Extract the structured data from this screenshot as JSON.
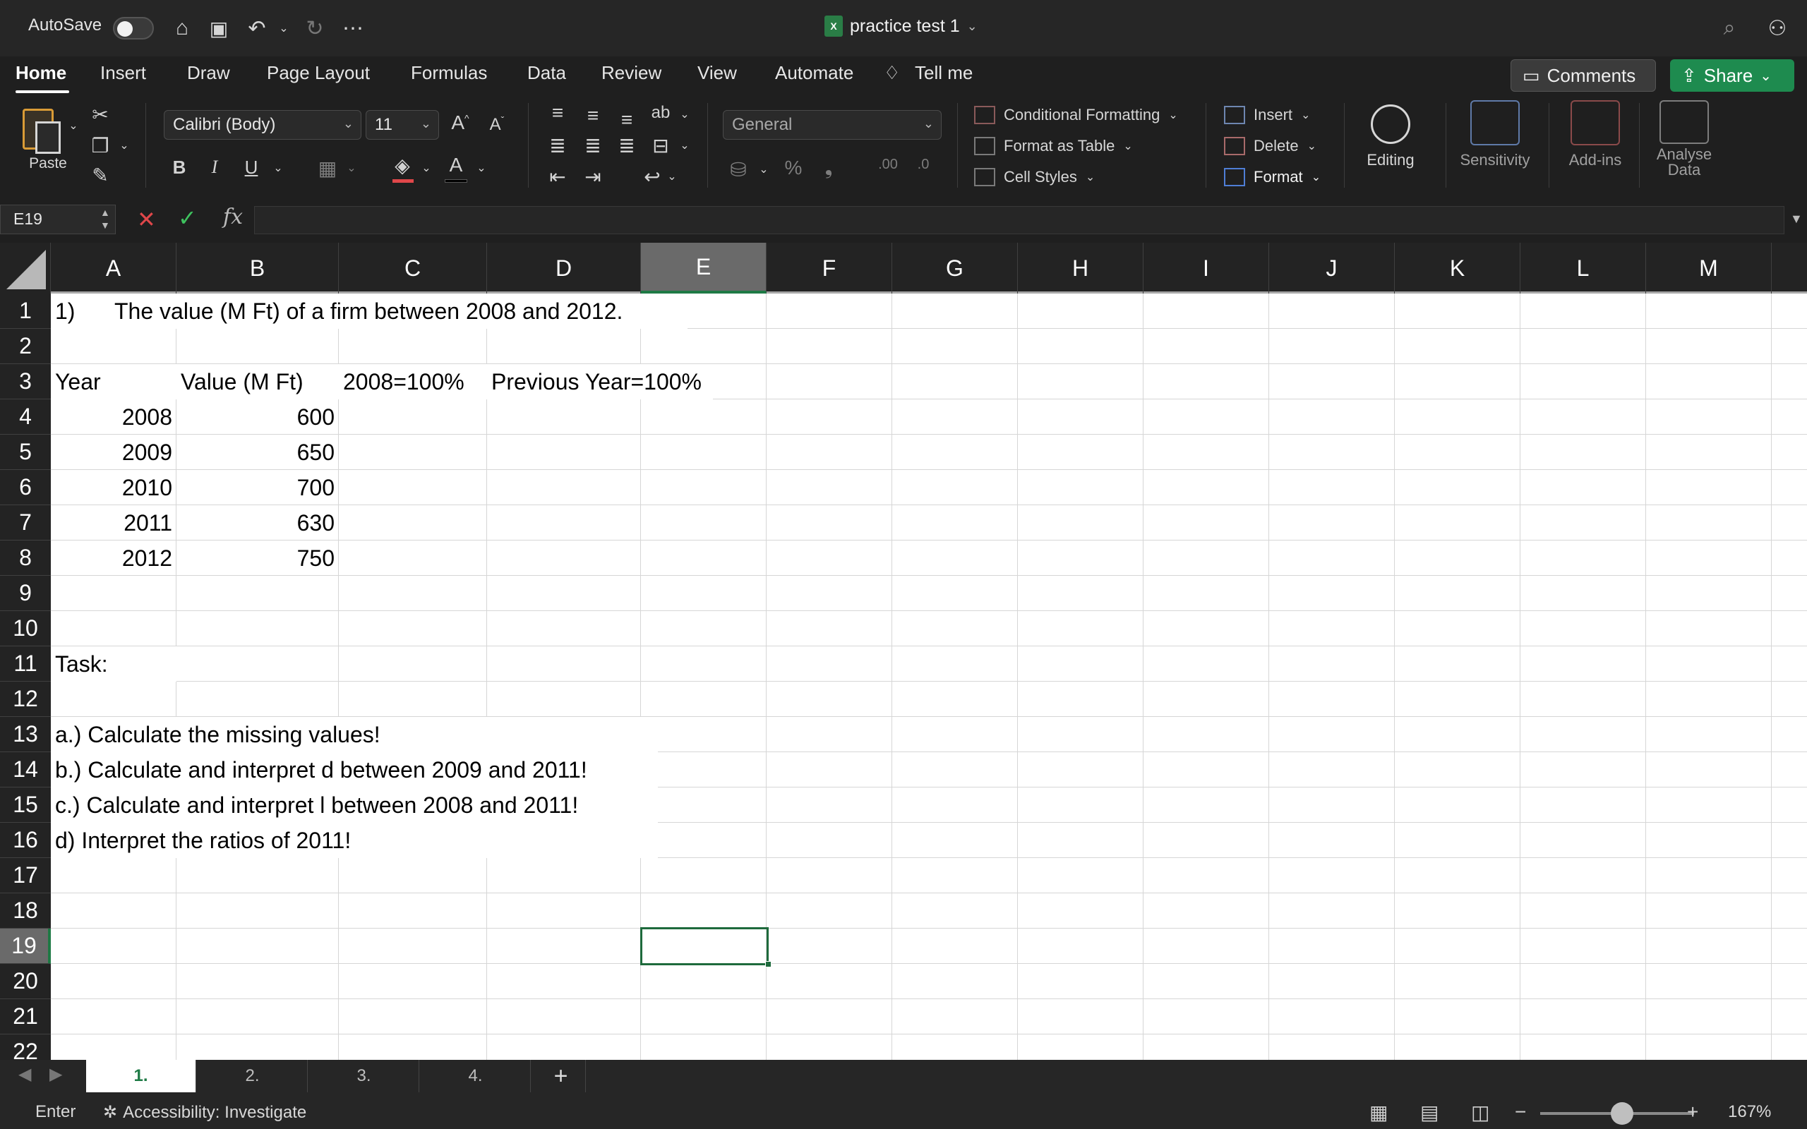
{
  "titlebar": {
    "autosave_label": "AutoSave",
    "document_title": "practice test 1",
    "file_badge": "X"
  },
  "ribbon_tabs": [
    "Home",
    "Insert",
    "Draw",
    "Page Layout",
    "Formulas",
    "Data",
    "Review",
    "View",
    "Automate",
    "Tell me"
  ],
  "top_buttons": {
    "comments": "Comments",
    "share": "Share"
  },
  "ribbon": {
    "paste_label": "Paste",
    "font_name": "Calibri (Body)",
    "font_size": "11",
    "number_format": "General",
    "conditional_formatting": "Conditional Formatting",
    "format_as_table": "Format as Table",
    "cell_styles": "Cell Styles",
    "insert": "Insert",
    "delete": "Delete",
    "format": "Format",
    "editing": "Editing",
    "sensitivity": "Sensitivity",
    "addins": "Add-ins",
    "analyse_line1": "Analyse",
    "analyse_line2": "Data"
  },
  "formula_bar": {
    "name_box": "E19",
    "fx": "fx",
    "formula": ""
  },
  "columns": [
    "A",
    "B",
    "C",
    "D",
    "E",
    "F",
    "G",
    "H",
    "I",
    "J",
    "K",
    "L",
    "M"
  ],
  "rows": [
    "1",
    "2",
    "3",
    "4",
    "5",
    "6",
    "7",
    "8",
    "9",
    "10",
    "11",
    "12",
    "13",
    "14",
    "15",
    "16",
    "17",
    "18",
    "19",
    "20",
    "21",
    "22"
  ],
  "selected_cell": "E19",
  "cells": {
    "A1": "1)",
    "A1_text": "The value (M Ft) of a firm between 2008 and 2012.",
    "A3": "Year",
    "B3": "Value (M Ft)",
    "C3": "2008=100%",
    "D3": "Previous Year=100%",
    "A4": "2008",
    "B4": "600",
    "A5": "2009",
    "B5": "650",
    "A6": "2010",
    "B6": "700",
    "A7": "2011",
    "B7": "630",
    "A8": "2012",
    "B8": "750",
    "A11": "Task:",
    "A13": "a.) Calculate the missing values!",
    "A14": "b.) Calculate and interpret d between 2009 and 2011!",
    "A15": "c.) Calculate and interpret l between 2008 and 2011!",
    "A16": "d) Interpret the ratios of 2011!"
  },
  "sheet_tabs": [
    "1.",
    "2.",
    "3.",
    "4."
  ],
  "active_sheet": "1.",
  "status": {
    "mode": "Enter",
    "accessibility": "Accessibility: Investigate",
    "zoom": "167%"
  }
}
